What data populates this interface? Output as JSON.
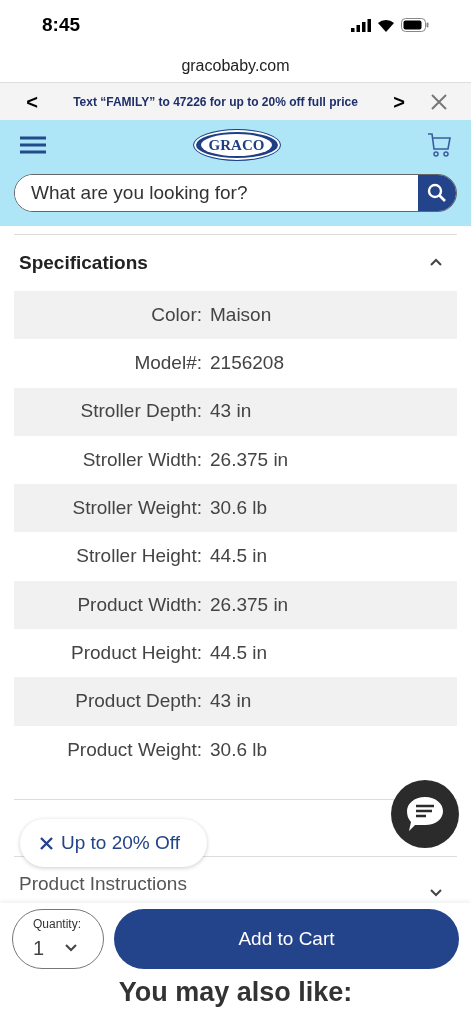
{
  "status_bar": {
    "time": "8:45"
  },
  "address_bar": {
    "url": "gracobaby.com"
  },
  "promo_banner": {
    "prev": "<",
    "text": "Text “FAMILY” to 47226 for up to 20% off full price",
    "next": ">"
  },
  "header": {
    "logo": "GRACO",
    "search": {
      "placeholder": "What are you looking for?"
    }
  },
  "specifications": {
    "title": "Specifications",
    "expanded": true,
    "rows": [
      {
        "label": "Color:",
        "value": "Maison"
      },
      {
        "label": "Model#:",
        "value": "2156208"
      },
      {
        "label": "Stroller Depth:",
        "value": "43 in"
      },
      {
        "label": "Stroller Width:",
        "value": "26.375 in"
      },
      {
        "label": "Stroller Weight:",
        "value": "30.6 lb"
      },
      {
        "label": "Stroller Height:",
        "value": "44.5 in"
      },
      {
        "label": "Product Width:",
        "value": "26.375 in"
      },
      {
        "label": "Product Height:",
        "value": "44.5 in"
      },
      {
        "label": "Product Depth:",
        "value": "43 in"
      },
      {
        "label": "Product Weight:",
        "value": "30.6 lb"
      }
    ]
  },
  "offer_pill": {
    "text": "Up to 20% Off"
  },
  "instructions": {
    "title": "Product Instructions",
    "expanded": false
  },
  "cart_bar": {
    "quantity_label": "Quantity:",
    "quantity": "1",
    "button": "Add to Cart"
  },
  "recommendations": {
    "title": "You may also like:"
  }
}
